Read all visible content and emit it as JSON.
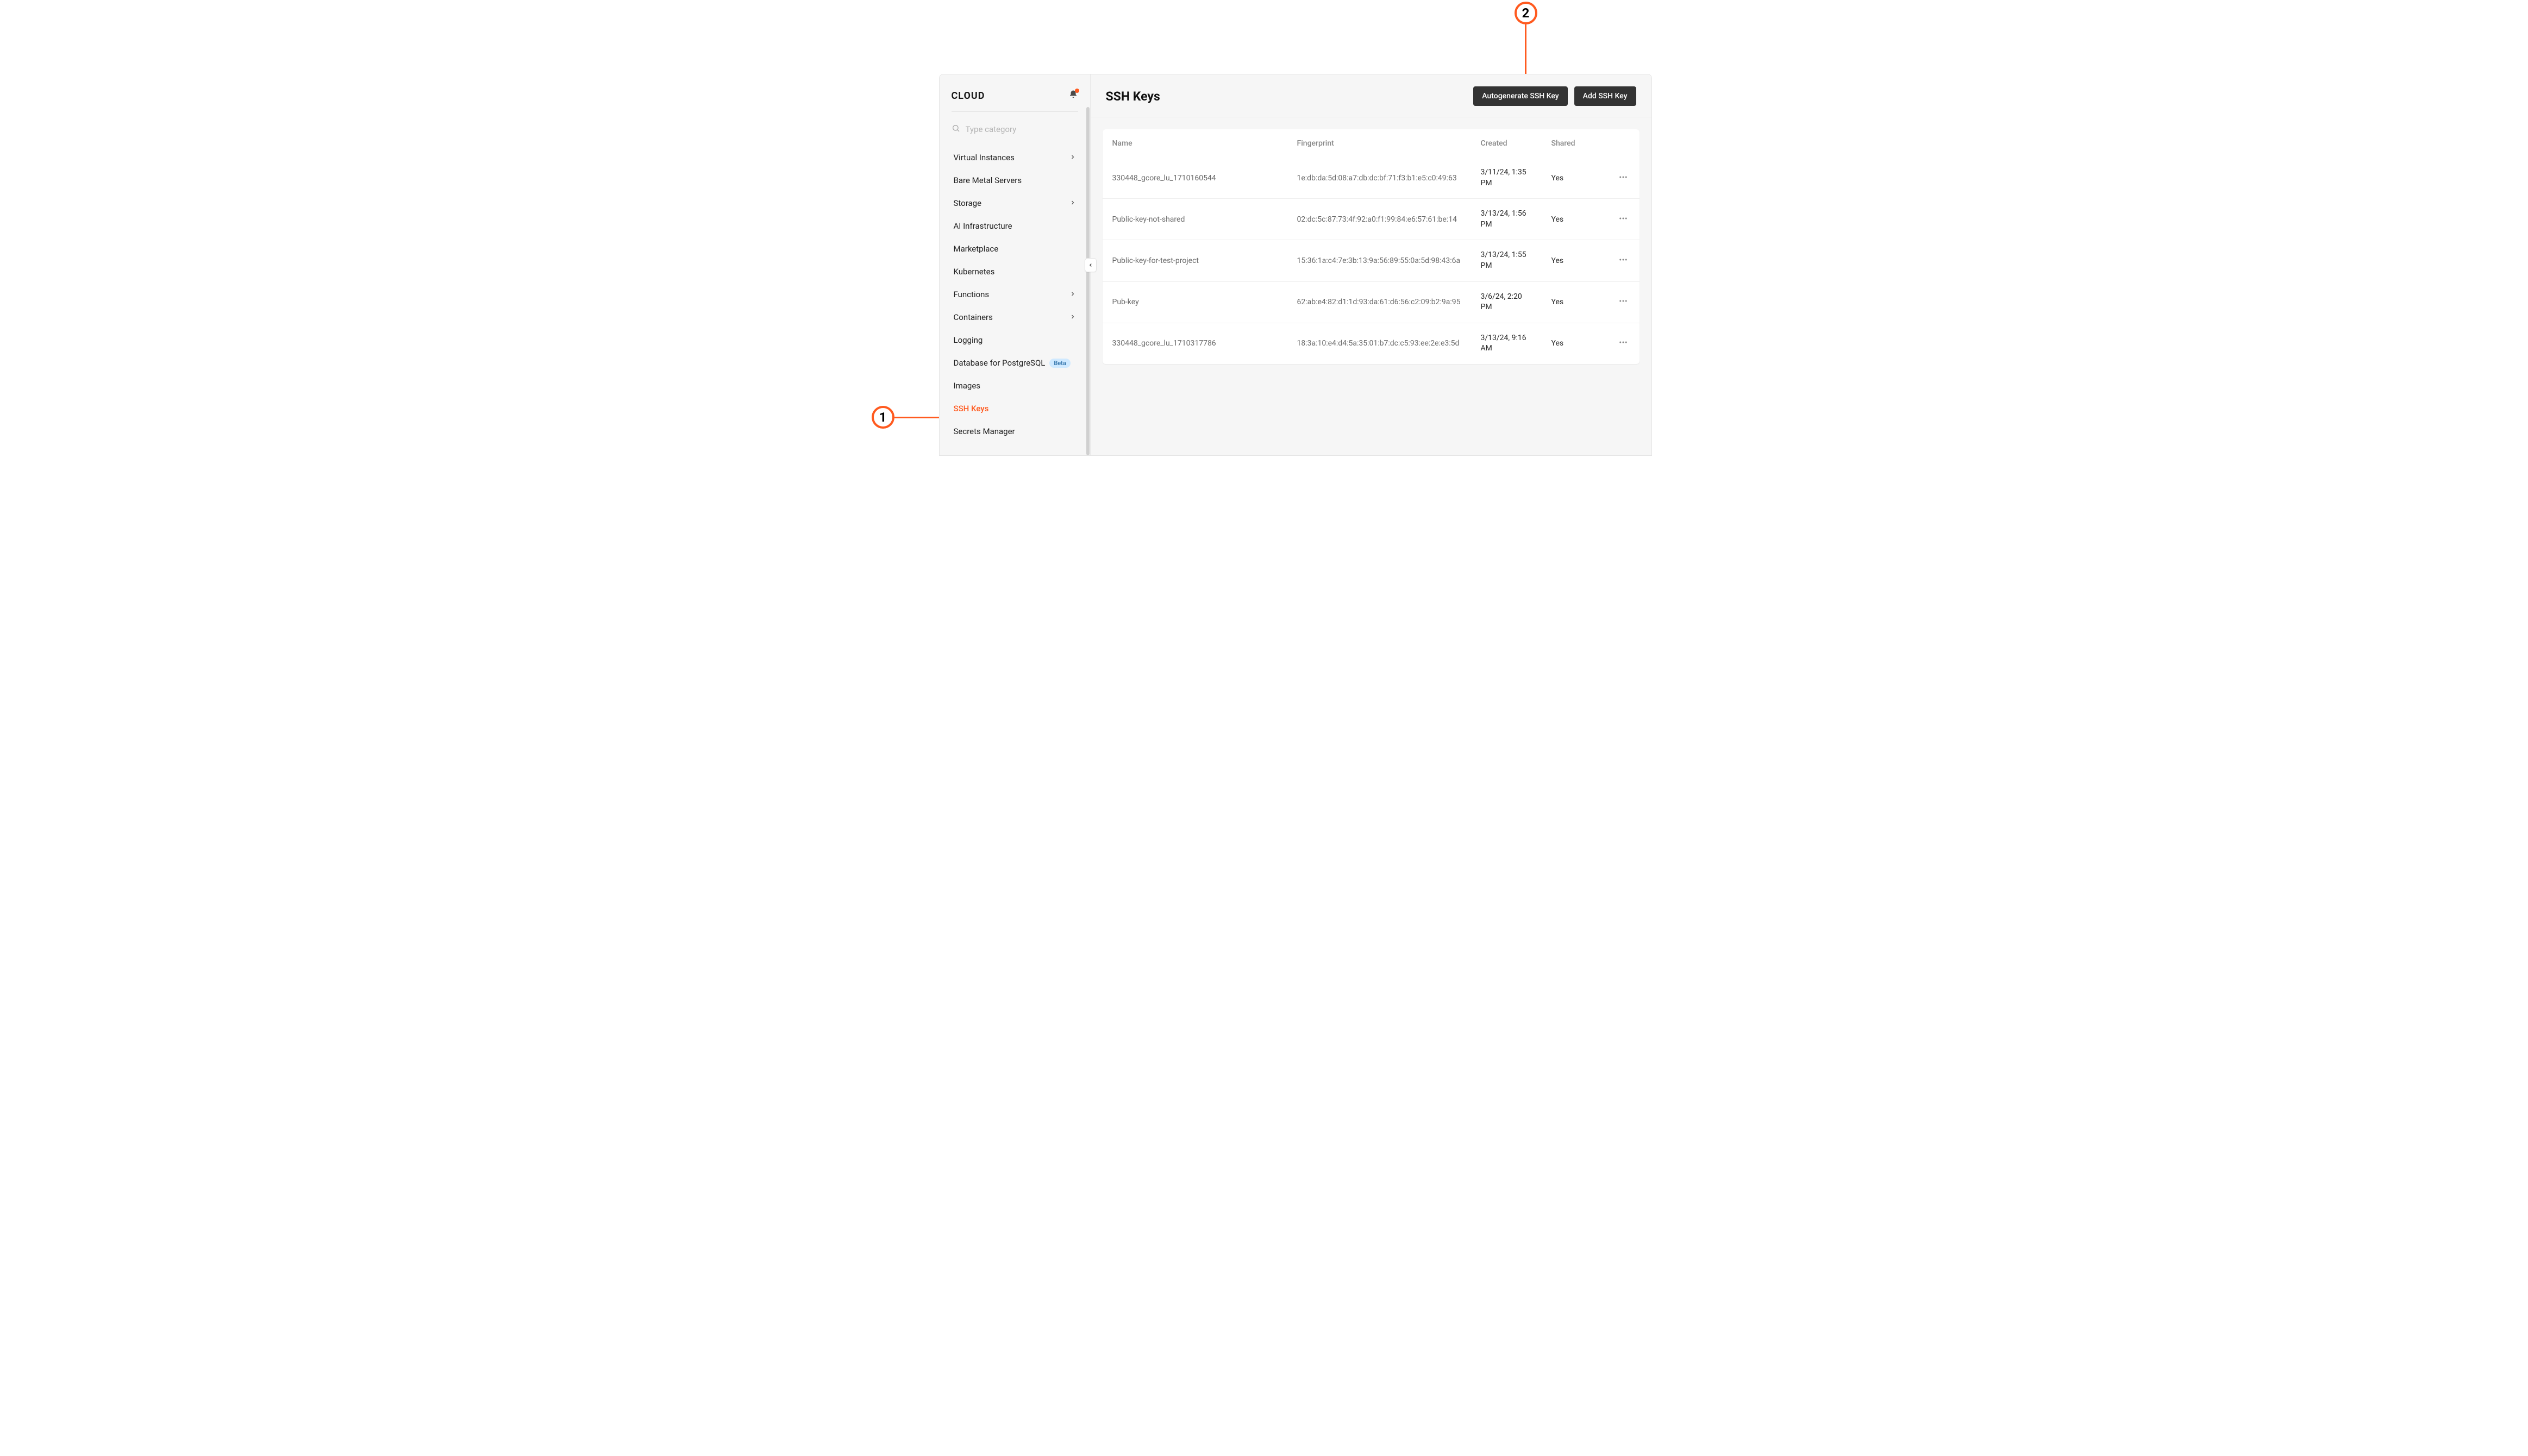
{
  "annotations": {
    "1": "1",
    "2": "2"
  },
  "sidebar": {
    "brand": "CLOUD",
    "search_placeholder": "Type category",
    "items": [
      {
        "label": "Virtual Instances",
        "expandable": true
      },
      {
        "label": "Bare Metal Servers",
        "expandable": false
      },
      {
        "label": "Storage",
        "expandable": true
      },
      {
        "label": "AI Infrastructure",
        "expandable": false
      },
      {
        "label": "Marketplace",
        "expandable": false
      },
      {
        "label": "Kubernetes",
        "expandable": false
      },
      {
        "label": "Functions",
        "expandable": true
      },
      {
        "label": "Containers",
        "expandable": true
      },
      {
        "label": "Logging",
        "expandable": false
      },
      {
        "label": "Database for PostgreSQL",
        "expandable": false,
        "badge": "Beta"
      },
      {
        "label": "Images",
        "expandable": false
      },
      {
        "label": "SSH Keys",
        "expandable": false,
        "active": true
      },
      {
        "label": "Secrets Manager",
        "expandable": false
      }
    ]
  },
  "header": {
    "title": "SSH Keys",
    "autogenerate_label": "Autogenerate SSH Key",
    "add_label": "Add SSH Key"
  },
  "table": {
    "columns": {
      "name": "Name",
      "fingerprint": "Fingerprint",
      "created": "Created",
      "shared": "Shared"
    },
    "rows": [
      {
        "name": "330448_gcore_lu_1710160544",
        "fingerprint": "1e:db:da:5d:08:a7:db:dc:bf:71:f3:b1:e5:c0:49:63",
        "created": "3/11/24, 1:35 PM",
        "shared": "Yes"
      },
      {
        "name": "Public-key-not-shared",
        "fingerprint": "02:dc:5c:87:73:4f:92:a0:f1:99:84:e6:57:61:be:14",
        "created": "3/13/24, 1:56 PM",
        "shared": "Yes"
      },
      {
        "name": "Public-key-for-test-project",
        "fingerprint": "15:36:1a:c4:7e:3b:13:9a:56:89:55:0a:5d:98:43:6a",
        "created": "3/13/24, 1:55 PM",
        "shared": "Yes"
      },
      {
        "name": "Pub-key",
        "fingerprint": "62:ab:e4:82:d1:1d:93:da:61:d6:56:c2:09:b2:9a:95",
        "created": "3/6/24, 2:20 PM",
        "shared": "Yes"
      },
      {
        "name": "330448_gcore_lu_1710317786",
        "fingerprint": "18:3a:10:e4:d4:5a:35:01:b7:dc:c5:93:ee:2e:e3:5d",
        "created": "3/13/24, 9:16 AM",
        "shared": "Yes"
      }
    ]
  }
}
